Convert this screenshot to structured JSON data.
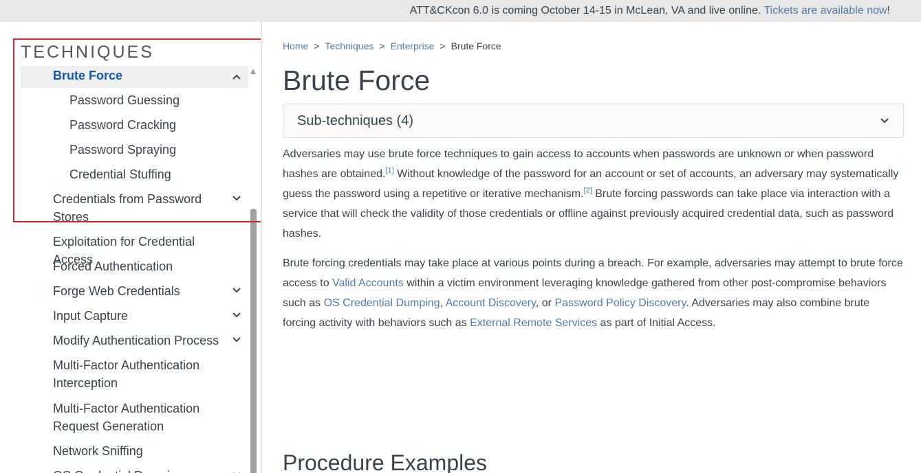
{
  "banner": {
    "text": "ATT&CKcon 6.0 is coming October 14-15 in McLean, VA and live online. ",
    "link": "Tickets are available now",
    "suffix": "!"
  },
  "sidebar": {
    "title": "TECHNIQUES",
    "active_item": "Brute Force",
    "sub_items": [
      "Password Guessing",
      "Password Cracking",
      "Password Spraying",
      "Credential Stuffing"
    ],
    "items": [
      "Credentials from Password Stores",
      "Exploitation for Credential Access",
      "Forced Authentication",
      "Forge Web Credentials",
      "Input Capture",
      "Modify Authentication Process",
      "Multi-Factor Authentication Interception",
      "Multi-Factor Authentication Request Generation",
      "Network Sniffing",
      "OS Credential Dumping"
    ]
  },
  "breadcrumb": {
    "home": "Home",
    "techniques": "Techniques",
    "enterprise": "Enterprise",
    "current": "Brute Force",
    "separator": ">"
  },
  "page": {
    "title": "Brute Force",
    "subtechniques_label": "Sub-techniques (4)",
    "section_title": "Procedure Examples"
  },
  "description": {
    "p1_a": "Adversaries may use brute force techniques to gain access to accounts when passwords are unknown or when password hashes are obtained.",
    "ref1": "[1]",
    "p1_b": " Without knowledge of the password for an account or set of accounts, an adversary may systematically guess the password using a repetitive or iterative mechanism.",
    "ref2": "[2]",
    "p1_c": " Brute forcing passwords can take place via interaction with a service that will check the validity of those credentials or offline against previously acquired credential data, such as password hashes.",
    "p2_a": "Brute forcing credentials may take place at various points during a breach. For example, adversaries may attempt to brute force access to ",
    "link_valid_accounts": "Valid Accounts",
    "p2_b": " within a victim environment leveraging knowledge gathered from other post-compromise behaviors such as ",
    "link_os_cred": "OS Credential Dumping",
    "p2_c": ", ",
    "link_account_discovery": "Account Discovery",
    "p2_d": ", or ",
    "link_password_policy": "Password Policy Discovery",
    "p2_e": ". Adversaries may also combine brute forcing activity with behaviors such as ",
    "link_external_remote": "External Remote Services",
    "p2_f": " as part of Initial Access."
  },
  "colors": {
    "accent": "#0b59b4",
    "link": "#4f7cac",
    "highlight_box": "#d7262a",
    "banner_bg": "#e8e8e8"
  }
}
